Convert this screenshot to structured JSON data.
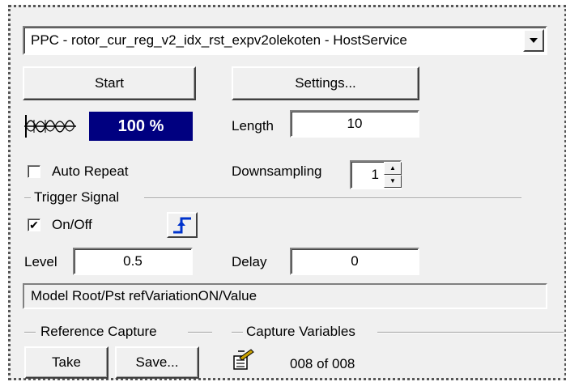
{
  "service_select": {
    "value": "PPC - rotor_cur_reg_v2_idx_rst_expv2olekoten - HostService"
  },
  "buttons": {
    "start": "Start",
    "settings": "Settings...",
    "take": "Take",
    "save": "Save..."
  },
  "progress": {
    "text": "100 %",
    "value_percent": 100
  },
  "length": {
    "label": "Length",
    "value": "10"
  },
  "auto_repeat": {
    "label": "Auto Repeat",
    "checked": false
  },
  "downsampling": {
    "label": "Downsampling",
    "value": "1"
  },
  "trigger": {
    "group_label": "Trigger Signal",
    "onoff_label": "On/Off",
    "onoff_checked": true,
    "level_label": "Level",
    "level_value": "0.5",
    "delay_label": "Delay",
    "delay_value": "0"
  },
  "signal_path": "Model Root/Pst  refVariationON/Value",
  "reference_capture": {
    "group_label": "Reference Capture"
  },
  "capture_variables": {
    "group_label": "Capture Variables",
    "count_text": "008 of 008"
  },
  "icons": {
    "waveform": "signal-waveform-icon",
    "trigger_edge": "rising-edge-icon",
    "capture_variables": "variables-icon",
    "dropdown": "chevron-down-icon"
  },
  "colors": {
    "progress_bg": "#000080",
    "progress_text": "#ffffff",
    "trigger_icon": "#0033cc"
  }
}
